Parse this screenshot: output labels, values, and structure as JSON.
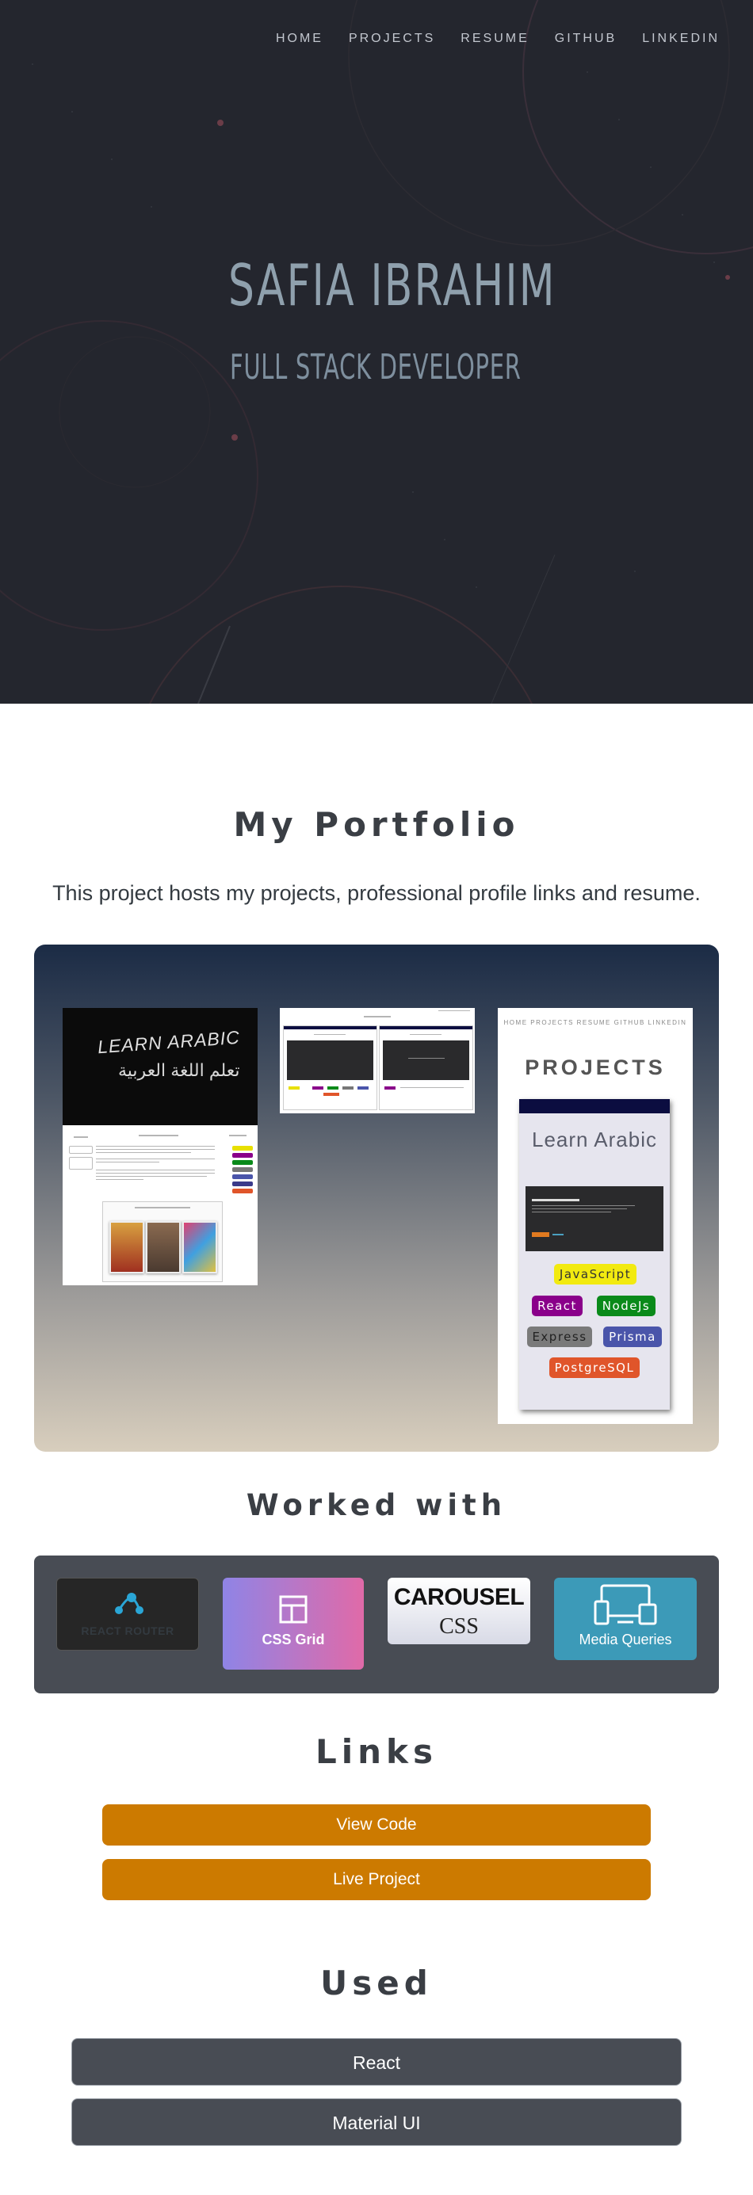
{
  "nav": {
    "items": [
      "HOME",
      "PROJECTS",
      "RESUME",
      "GITHUB",
      "LINKEDIN"
    ]
  },
  "hero": {
    "name": "SAFIA IBRAHIM",
    "role": "FULL STACK DEVELOPER"
  },
  "portfolio": {
    "title": "My Portfolio",
    "description": "This project hosts my projects, professional profile links and resume."
  },
  "gallery": {
    "shot1": {
      "chalk_en": "LEARN ARABIC",
      "chalk_ar": "تعلم اللغة العربية"
    },
    "shot3": {
      "nav": "HOME  PROJECTS  RESUME  GITHUB  LINKEDIN",
      "title": "PROJECTS",
      "card_title": "Learn Arabic",
      "tags": [
        "JavaScript",
        "React",
        "NodeJs",
        "Express",
        "Prisma",
        "PostgreSQL"
      ]
    }
  },
  "worked_with": {
    "title": "Worked with",
    "tiles": [
      "REACT ROUTER",
      "CSS Grid",
      "CAROUSEL",
      "CSS",
      "Media Queries"
    ]
  },
  "links": {
    "title": "Links",
    "view_code": "View Code",
    "live_project": "Live Project"
  },
  "used": {
    "title": "Used",
    "items": [
      "React",
      "Material UI"
    ]
  },
  "colors": {
    "accent_orange": "#cc7a00",
    "panel_gray": "#484c54",
    "hero_bg": "#24262e"
  }
}
